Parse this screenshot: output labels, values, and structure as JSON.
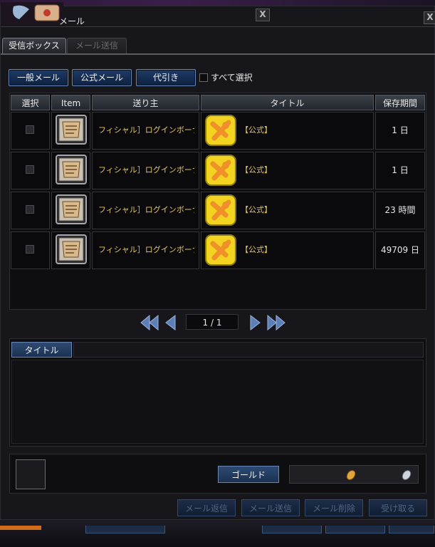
{
  "window": {
    "title": "メール",
    "close_label": "X"
  },
  "tabs": [
    {
      "label": "受信ボックス",
      "active": true
    },
    {
      "label": "メール送信",
      "active": false
    }
  ],
  "filters": {
    "general_label": "一般メール",
    "official_label": "公式メール",
    "cod_label": "代引き",
    "select_all_label": "すべて選択"
  },
  "table": {
    "headers": [
      "選択",
      "Item",
      "送り主",
      "タイトル",
      "保存期間"
    ],
    "rows": [
      {
        "sender": "フィシャル］ログインボーナ",
        "title": "【公式】",
        "keep": "1 日"
      },
      {
        "sender": "フィシャル］ログインボーナ",
        "title": "【公式】",
        "keep": "1 日"
      },
      {
        "sender": "フィシャル］ログインボーナ",
        "title": "【公式】",
        "keep": "23 時間"
      },
      {
        "sender": "フィシャル］ログインボーナ",
        "title": "【公式】",
        "keep": "49709 日"
      }
    ]
  },
  "pager": {
    "page_text": "1 / 1"
  },
  "detail": {
    "title_tab_label": "タイトル"
  },
  "attachment": {
    "gold_label": "ゴールド"
  },
  "actions": {
    "reply_label": "メール返信",
    "forward_label": "メール送信",
    "delete_label": "メール削除",
    "receive_label": "受け取る"
  },
  "colors": {
    "accent_blue": "#1d3a66",
    "gold_text": "#e6c45c",
    "title_icon_yellow": "#f2d31f"
  }
}
